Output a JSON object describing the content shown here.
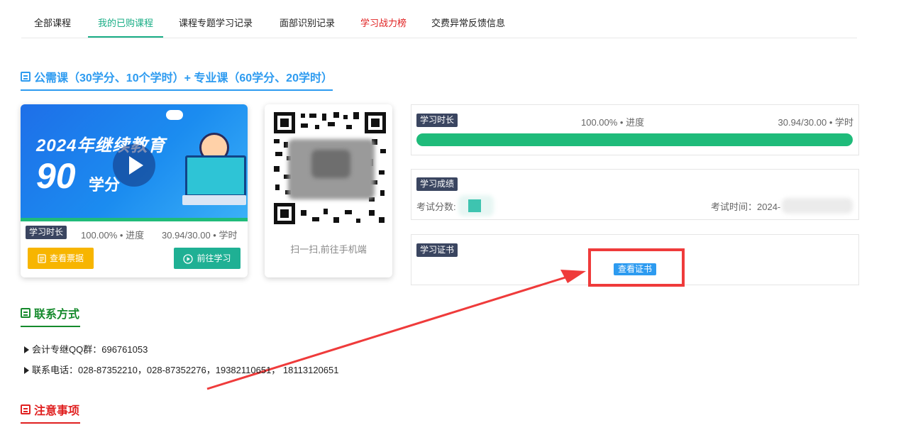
{
  "tabs": [
    {
      "label": "全部课程"
    },
    {
      "label": "我的已购课程"
    },
    {
      "label": "课程专题学习记录"
    },
    {
      "label": "面部识别记录"
    },
    {
      "label": "学习战力榜"
    },
    {
      "label": "交费异常反馈信息"
    }
  ],
  "colors": {
    "accent": "#1aae86",
    "blue": "#2d9bf0",
    "red": "#e02020",
    "dark_label": "#3a4560",
    "orange": "#f7b500",
    "teal": "#1fb094"
  },
  "course_section": {
    "title": "公需课（30学分、10个学时）+ 专业课（60学分、20学时）"
  },
  "course_card": {
    "banner_title": "2024年继续教育",
    "banner_number": "90",
    "banner_unit": "学分",
    "study_time_label": "学习时长",
    "progress_text": "100.00% • 进度",
    "hours_text": "30.94/30.00 • 学时",
    "progress_percent": 100,
    "view_invoice_label": "查看票据",
    "go_study_label": "前往学习"
  },
  "qr_card": {
    "caption": "扫一扫,前往手机端"
  },
  "study_time_panel": {
    "label": "学习时长",
    "progress_text": "100.00% • 进度",
    "hours_text": "30.94/30.00 • 学时",
    "progress_percent": 100
  },
  "score_panel": {
    "label": "学习成绩",
    "score_label": "考试分数:",
    "time_label": "考试时间：2024-"
  },
  "certificate_panel": {
    "label": "学习证书",
    "view_button": "查看证书"
  },
  "contact_section": {
    "title": "联系方式",
    "items": [
      {
        "label": "会计专继QQ群：",
        "value": "696761053"
      },
      {
        "label": "联系电话：",
        "value": "028-87352210，028-87352276，19382110651， 18113120651"
      }
    ]
  },
  "notice_section": {
    "title": "注意事项"
  },
  "icons": [
    "notepad-icon",
    "play-icon",
    "receipt-icon",
    "play-circle-icon",
    "triangle-bullet-icon",
    "qr-code-icon"
  ]
}
